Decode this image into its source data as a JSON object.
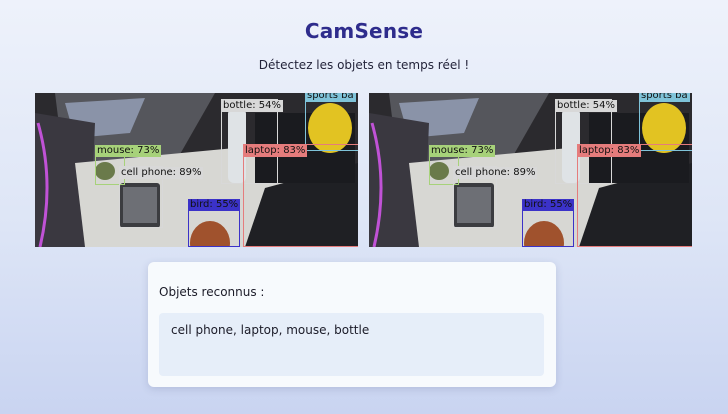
{
  "app": {
    "title": "CamSense",
    "subtitle": "Détectez les objets en temps réel !"
  },
  "detections": [
    {
      "label": "bottle: 54%",
      "color": "#d8d8d8"
    },
    {
      "label": "sports ba",
      "color": "#7fc3d9"
    },
    {
      "label": "mouse: 73%",
      "color": "#a7d27a"
    },
    {
      "label": "laptop: 83%",
      "color": "#e57c7c"
    },
    {
      "label": "cell phone: 89%",
      "color": "#d8d8d8"
    },
    {
      "label": "bird: 55%",
      "color": "#3b32c8"
    }
  ],
  "results": {
    "heading": "Objets reconnus :",
    "value": "cell phone, laptop, mouse, bottle"
  },
  "colors": {
    "accent": "#2e2c8c",
    "card_bg": "#f7fafd",
    "result_bg": "#e6eef9"
  }
}
